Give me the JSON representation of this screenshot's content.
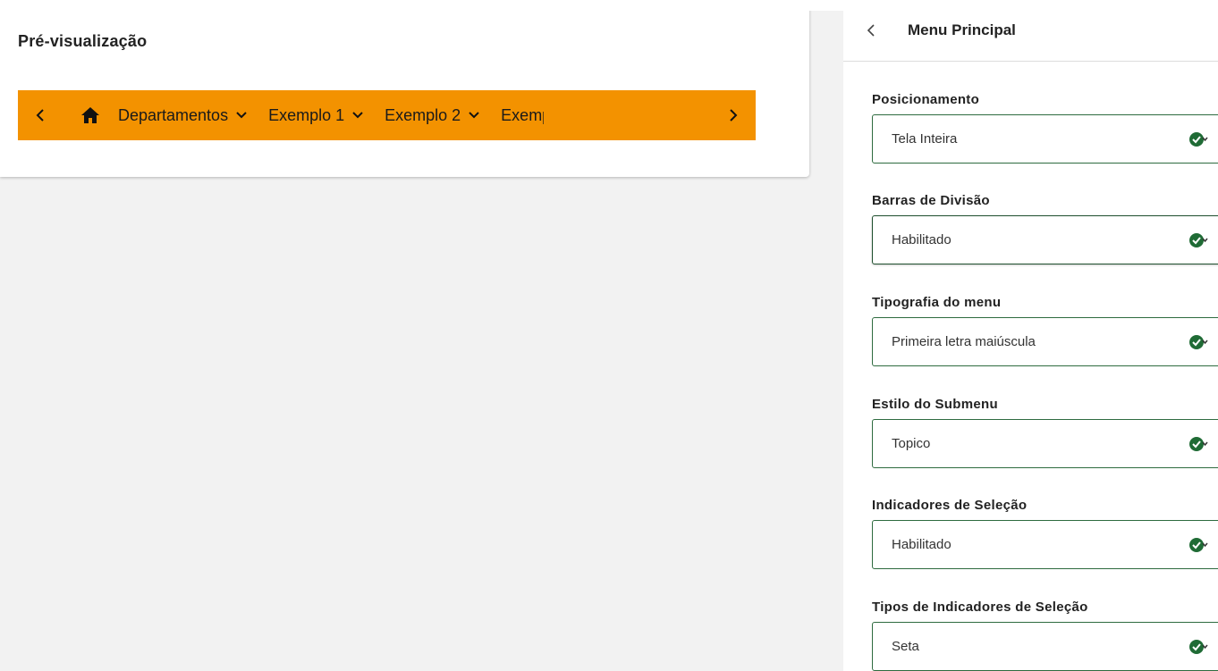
{
  "preview": {
    "title": "Pré-visualização",
    "nav": {
      "items": [
        {
          "label": "Departamentos"
        },
        {
          "label": "Exemplo 1"
        },
        {
          "label": "Exemplo 2"
        },
        {
          "label": "Exemp"
        }
      ],
      "background_color": "#f39200"
    }
  },
  "panel": {
    "title": "Menu Principal",
    "fields": [
      {
        "label": "Posicionamento",
        "value": "Tela Inteira"
      },
      {
        "label": "Barras de Divisão",
        "value": "Habilitado"
      },
      {
        "label": "Tipografia do menu",
        "value": "Primeira letra maiúscula"
      },
      {
        "label": "Estilo do Submenu",
        "value": "Topico"
      },
      {
        "label": "Indicadores de Seleção",
        "value": "Habilitado"
      },
      {
        "label": "Tipos de Indicadores de Seleção",
        "value": "Seta"
      }
    ],
    "accent_color": "#1f6b35"
  }
}
